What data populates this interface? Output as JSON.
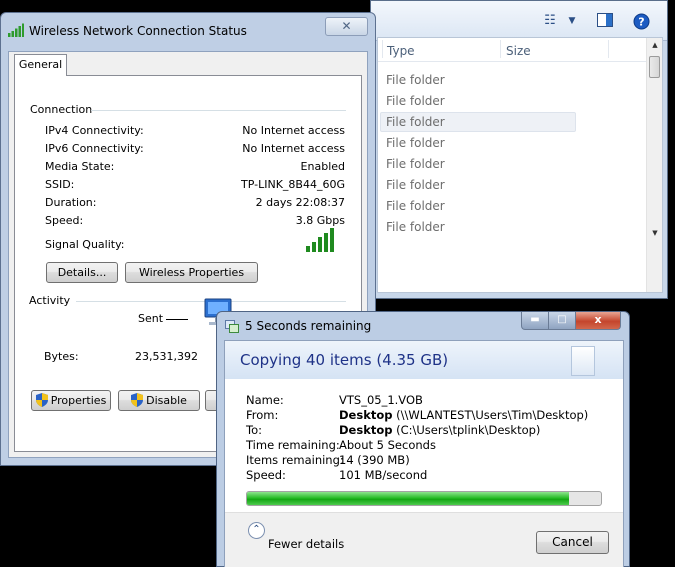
{
  "explorer": {
    "columns": {
      "type": "Type",
      "size": "Size"
    },
    "rows": [
      "File folder",
      "File folder",
      "File folder",
      "File folder",
      "File folder",
      "File folder",
      "File folder",
      "File folder"
    ],
    "icons": {
      "views": "views-icon",
      "preview": "preview-pane-icon",
      "help": "help-icon"
    }
  },
  "wifi": {
    "title": "Wireless Network Connection Status",
    "tab": "General",
    "connection_label": "Connection",
    "fields": [
      {
        "label": "IPv4 Connectivity:",
        "value": "No Internet access"
      },
      {
        "label": "IPv6 Connectivity:",
        "value": "No Internet access"
      },
      {
        "label": "Media State:",
        "value": "Enabled"
      },
      {
        "label": "SSID:",
        "value": "TP-LINK_8B44_60G"
      },
      {
        "label": "Duration:",
        "value": "2 days 22:08:37"
      },
      {
        "label": "Speed:",
        "value": "3.8 Gbps"
      }
    ],
    "signal_label": "Signal Quality:",
    "signal_bars": 5,
    "details_button": "Details...",
    "wireless_properties_button": "Wireless Properties",
    "activity_label": "Activity",
    "sent_label": "Sent",
    "bytes_label": "Bytes:",
    "bytes_sent": "23,531,392",
    "properties_button": "Properties",
    "disable_button": "Disable",
    "close_glyph": "✕"
  },
  "copy": {
    "title": "5 Seconds remaining",
    "heading": "Copying 40 items (4.35 GB)",
    "name_label": "Name:",
    "name_value": "VTS_05_1.VOB",
    "from_label": "From:",
    "from_bold": "Desktop",
    "from_path": " (\\\\WLANTEST\\Users\\Tim\\Desktop)",
    "to_label": "To:",
    "to_bold": "Desktop",
    "to_path": " (C:\\Users\\tplink\\Desktop)",
    "time_label": "Time remaining:",
    "time_value": "About 5 Seconds",
    "items_label": "Items remaining:",
    "items_value": "14 (390 MB)",
    "speed_label": "Speed:",
    "speed_value": "101 MB/second",
    "progress_fraction": 0.91,
    "fewer_details": "Fewer details",
    "cancel_button": "Cancel",
    "close_glyph": "x"
  }
}
